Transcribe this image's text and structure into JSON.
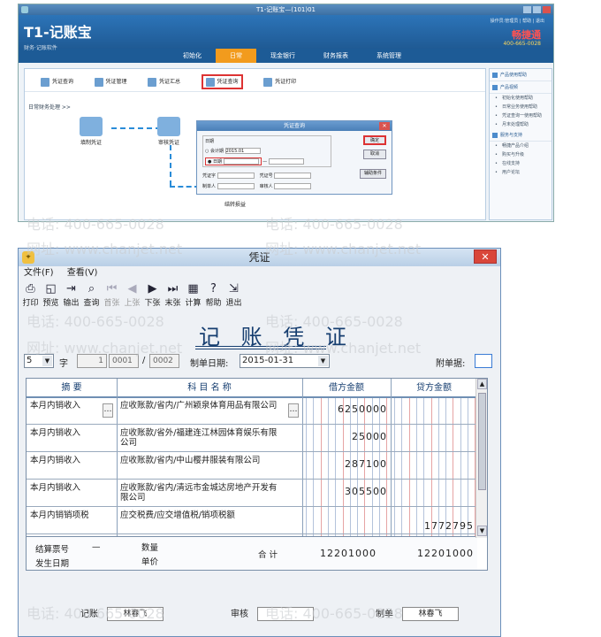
{
  "top_app": {
    "window_title": "T1-记账宝—(101)01",
    "logo": "T1-记账宝",
    "logo_sub": "财务·记账软件",
    "toplinks": "操作员:管理员 | 帮助 | 退出",
    "brand": "畅捷通",
    "phone": "400-665-0028",
    "menu": [
      "初始化",
      "日常",
      "现金银行",
      "财务报表",
      "系统管理"
    ],
    "toolbar": [
      "凭证查询",
      "凭证管理",
      "凭证汇总",
      "凭证查询",
      "凭证打印"
    ],
    "crumb": "日常财务处理 >>",
    "flow_nodes": [
      "填制凭证",
      "审核凭证",
      "结转损益"
    ],
    "dialog": {
      "title": "凭证查询",
      "group_label": "日期",
      "period_label": "会计期",
      "period_value": "2015.01",
      "date_label": "日期",
      "ok": "确定",
      "cancel": "取消",
      "more": "辅助条件",
      "f1": "凭证字",
      "f2": "凭证号",
      "f3": "制单人",
      "f4": "审核人"
    },
    "side": {
      "section1": "产品使用帮助",
      "section2": "产品视频",
      "items1": [
        "初始化使用帮助",
        "日常业务使用帮助",
        "凭证查询一使用帮助",
        "月末处理帮助"
      ],
      "section3": "服务与支持",
      "items2": [
        "畅捷产品介绍",
        "购买与升级",
        "在线支持",
        "用户论坛"
      ]
    }
  },
  "voucher": {
    "window_title": "凭证",
    "menu": [
      "文件(F)",
      "查看(V)"
    ],
    "tools": [
      {
        "glyph": "⎙",
        "label": "打印",
        "enabled": true
      },
      {
        "glyph": "◱",
        "label": "预览",
        "enabled": true
      },
      {
        "glyph": "⇥",
        "label": "输出",
        "enabled": true
      },
      {
        "glyph": "⌕",
        "label": "查询",
        "enabled": true
      },
      {
        "glyph": "⏮",
        "label": "首张",
        "enabled": false
      },
      {
        "glyph": "◀",
        "label": "上张",
        "enabled": false
      },
      {
        "glyph": "▶",
        "label": "下张",
        "enabled": true
      },
      {
        "glyph": "⏭",
        "label": "末张",
        "enabled": true
      },
      {
        "glyph": "▦",
        "label": "计算",
        "enabled": true
      },
      {
        "glyph": "?",
        "label": "帮助",
        "enabled": true
      },
      {
        "glyph": "⇲",
        "label": "退出",
        "enabled": true
      }
    ],
    "title": "记 账 凭 证",
    "word_select": "5",
    "word_label": "字",
    "number": "1",
    "seq_from": "0001",
    "seq_to": "0002",
    "seq_sep": "/",
    "date_label": "制单日期:",
    "date_value": "2015-01-31",
    "attach_label": "附单据:",
    "attach_value": "",
    "columns": [
      "摘  要",
      "科 目 名 称",
      "借方金额",
      "贷方金额"
    ],
    "rows": [
      {
        "summary": "本月内销收入",
        "account": "应收账款/省内/广州颖泉体育用品有限公司",
        "debit": "62500.00",
        "credit": ""
      },
      {
        "summary": "本月内销收入",
        "account": "应收账款/省外/福建连江林园体育娱乐有限公司",
        "debit": "250.00",
        "credit": ""
      },
      {
        "summary": "本月内销收入",
        "account": "应收账款/省内/中山樱井服装有限公司",
        "debit": "2871.00",
        "credit": ""
      },
      {
        "summary": "本月内销收入",
        "account": "应收账款/省内/清远市金城达房地产开发有限公司",
        "debit": "3055.00",
        "credit": ""
      },
      {
        "summary": "本月内销销项税",
        "account": "应交税费/应交增值税/销项税额",
        "debit": "",
        "credit": "17727.95"
      }
    ],
    "row_debit_digits": [
      "6250000",
      "25000",
      "287100",
      "305500",
      ""
    ],
    "row_credit_digits": [
      "",
      "",
      "",
      "",
      "1772795"
    ],
    "footer": {
      "settle_label": "结算票号",
      "settle_dash": "—",
      "qty_label": "数量",
      "date_label": "发生日期",
      "price_label": "单价",
      "total_label": "合 计",
      "total_debit": "12201000",
      "total_credit": "12201000"
    },
    "sign": {
      "bookkeep_label": "记账",
      "bookkeep_value": "林春飞",
      "audit_label": "审核",
      "audit_value": "",
      "maker_label": "制单",
      "maker_value": "林春飞"
    },
    "watermark_phone": "电话: 400-665-0028",
    "watermark_web": "网址: www.chanjet.net"
  }
}
